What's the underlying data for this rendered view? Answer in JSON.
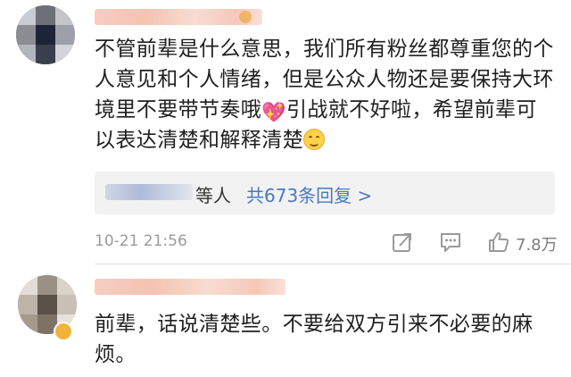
{
  "comments": [
    {
      "text_lines": [
        "不管前辈是什么意思，我们所有粉丝都尊重您的个",
        "人意见和个人情绪，但是公众人物还是要保持大环",
        "境里不要带节奏哦",
        "引战就不好啦，希望前辈可",
        "以表达清楚和解释清楚"
      ],
      "replies": {
        "suffix": "等人",
        "count_text": "共673条回复 >"
      },
      "timestamp": "10-21 21:56",
      "like_count": "7.8万"
    },
    {
      "text_lines": [
        "前辈，话说清楚些。不要给双方引来不必要的麻",
        "烦。"
      ]
    }
  ],
  "icons": {
    "heart_emoji": "sparkling-heart",
    "smile_emoji": "blush-smile",
    "share": "share-icon",
    "comment": "comment-icon",
    "like": "thumbs-up-icon"
  },
  "colors": {
    "link": "#4a78c2",
    "meta": "#9a9a9a",
    "reply_bg": "#f2f2f2"
  }
}
